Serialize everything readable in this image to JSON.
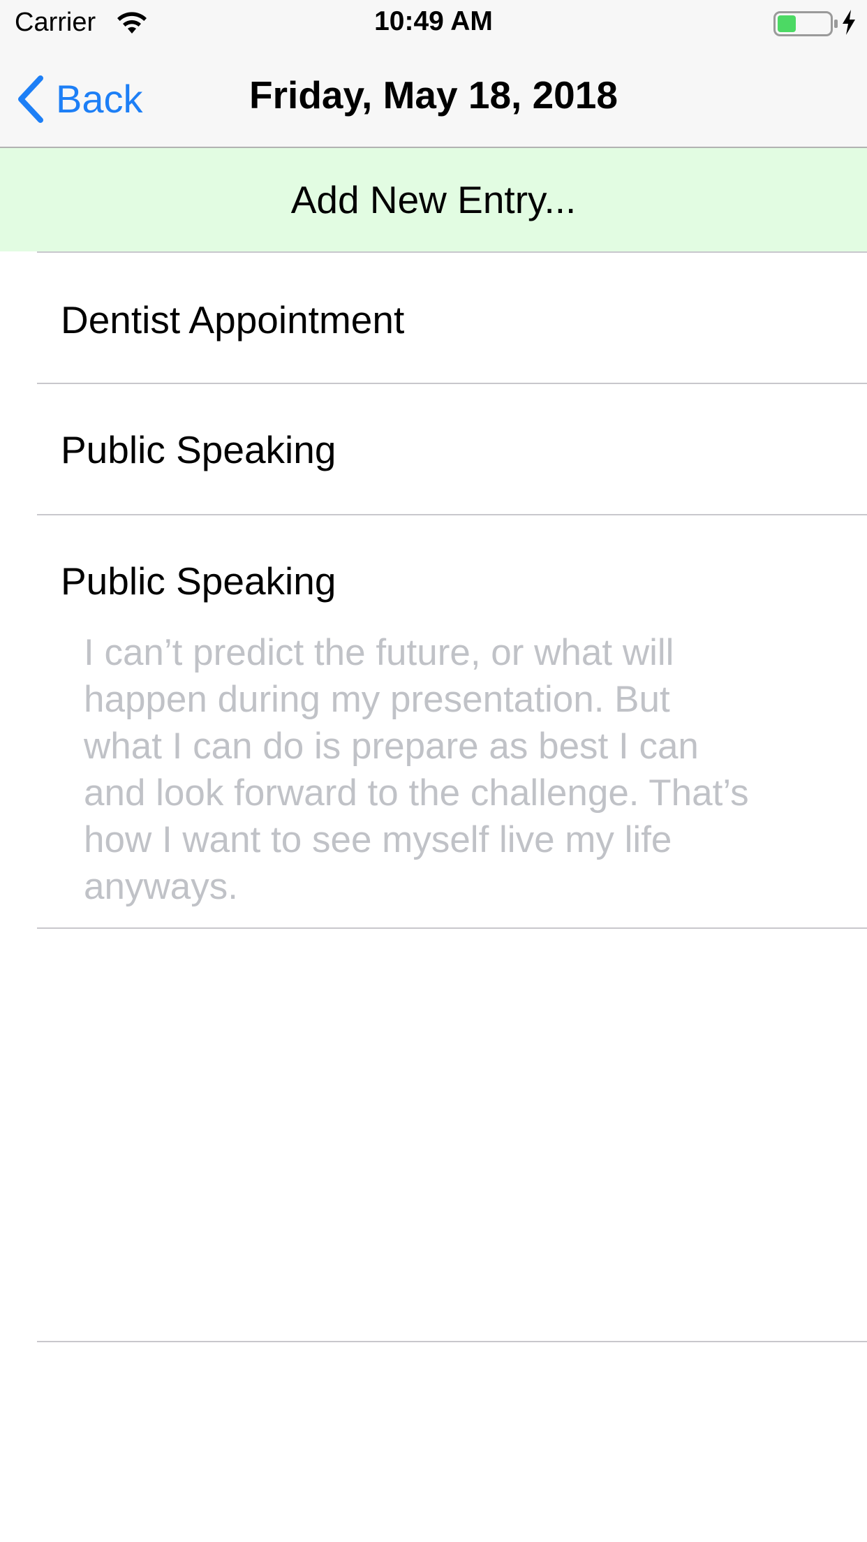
{
  "status_bar": {
    "carrier": "Carrier",
    "time": "10:49 AM",
    "wifi_icon": "wifi-icon",
    "battery_icon": "battery-icon",
    "battery_level_fraction": 0.35,
    "battery_color": "#4cd964",
    "charging_icon": "bolt-icon"
  },
  "nav": {
    "back_label": "Back",
    "title": "Friday, May 18, 2018",
    "accent_color": "#1d7ff6"
  },
  "add_entry": {
    "label": "Add New Entry...",
    "background_color": "#e2fce2"
  },
  "entries": [
    {
      "title": "Dentist Appointment"
    },
    {
      "title": "Public Speaking"
    },
    {
      "title": "Public Speaking",
      "note": "I can’t predict the future, or what will\nhappen during my presentation. But\nwhat I can do is prepare as best I can\nand look forward to the challenge. That’s\nhow I want to see myself live my life\nanyways."
    }
  ]
}
